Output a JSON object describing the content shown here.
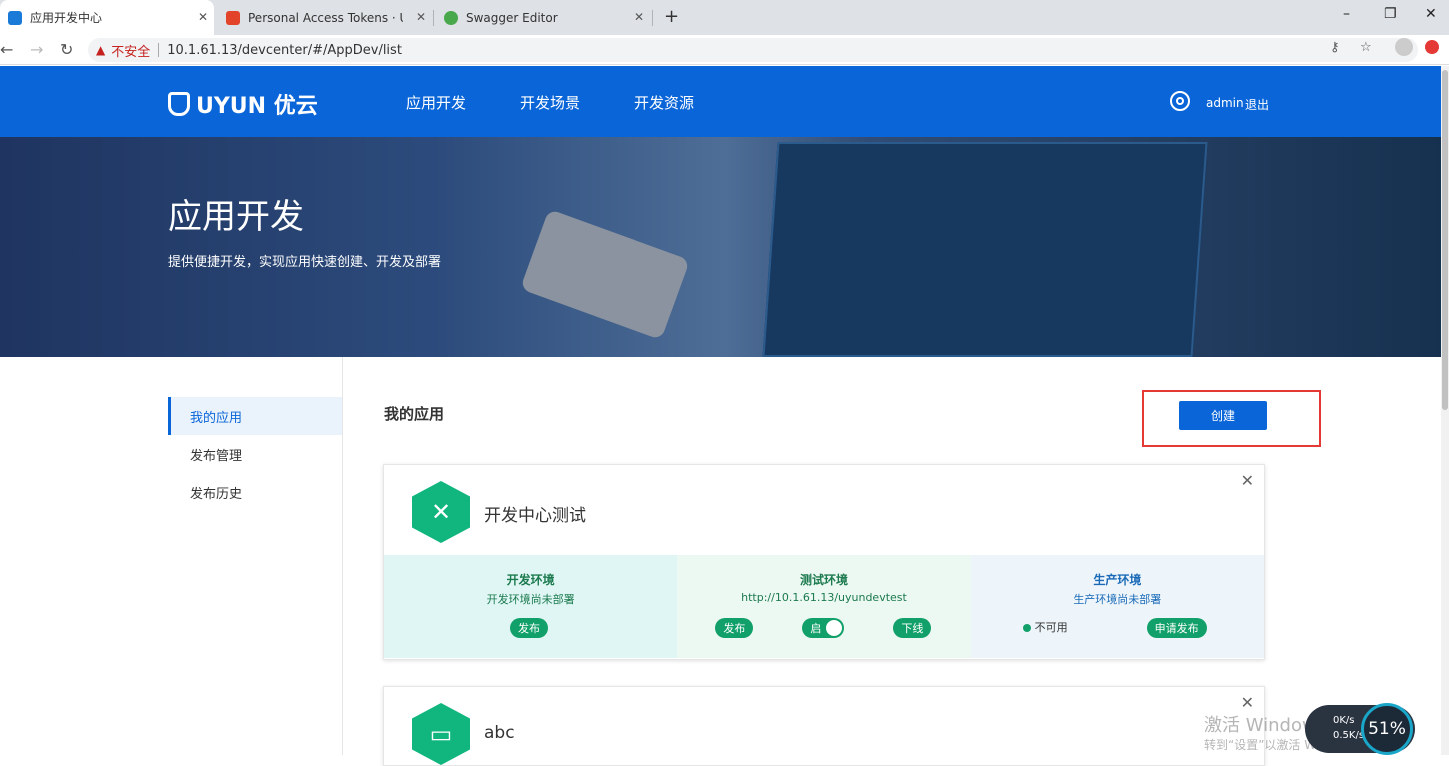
{
  "browser": {
    "tabs": [
      {
        "title": "应用开发中心",
        "icon_color": "#1a7ad8"
      },
      {
        "title": "Personal Access Tokens · User",
        "icon_color": "#e24329"
      },
      {
        "title": "Swagger Editor",
        "icon_color": "#49a84c"
      }
    ],
    "close_glyph": "✕",
    "new_tab": "+",
    "window_controls": [
      "–",
      "❐",
      "✕"
    ],
    "nav": {
      "back": "←",
      "forward": "→",
      "reload": "↻"
    },
    "security_warning": "不安全",
    "url": "10.1.61.13/devcenter/#/AppDev/list",
    "right_icons": [
      "key-icon",
      "star-icon",
      "profile-icon",
      "extension-icon"
    ]
  },
  "app": {
    "logo_text": "UYUN 优云",
    "nav": [
      "应用开发",
      "开发场景",
      "开发资源"
    ],
    "user": "admin",
    "logout": "退出"
  },
  "banner": {
    "title": "应用开发",
    "subtitle": "提供便捷开发，实现应用快速创建、开发及部署"
  },
  "sidebar": {
    "items": [
      "我的应用",
      "发布管理",
      "发布历史"
    ],
    "active": "我的应用"
  },
  "main": {
    "title": "我的应用",
    "create_label": "创建",
    "apps": [
      {
        "name": "开发中心测试",
        "icon": "tools-icon",
        "environments": [
          {
            "title": "开发环境",
            "subtitle": "开发环境尚未部署",
            "title_color": "#1b7a4e",
            "bg": "#dff6f4"
          },
          {
            "title": "测试环境",
            "subtitle": "http://10.1.61.13/uyundevtest",
            "title_color": "#1b7a4e",
            "bg": "#ecf8f2"
          },
          {
            "title": "生产环境",
            "subtitle": "生产环境尚未部署",
            "title_color": "#1a6ab8",
            "bg": "#eef5fa"
          }
        ],
        "dev_actions": {
          "publish": "发布"
        },
        "test_actions": {
          "publish": "发布",
          "toggle": "启",
          "offline": "下线"
        },
        "prod_actions": {
          "status": "不可用",
          "request": "申请发布"
        }
      },
      {
        "name": "abc",
        "icon": "image-icon"
      }
    ]
  },
  "overlay": {
    "activation_title": "激活 Windows",
    "activation_sub": "转到“设置”以激活 Windows。",
    "net_up": "0K/s",
    "net_down": "0.5K/s",
    "percent": "51%"
  }
}
